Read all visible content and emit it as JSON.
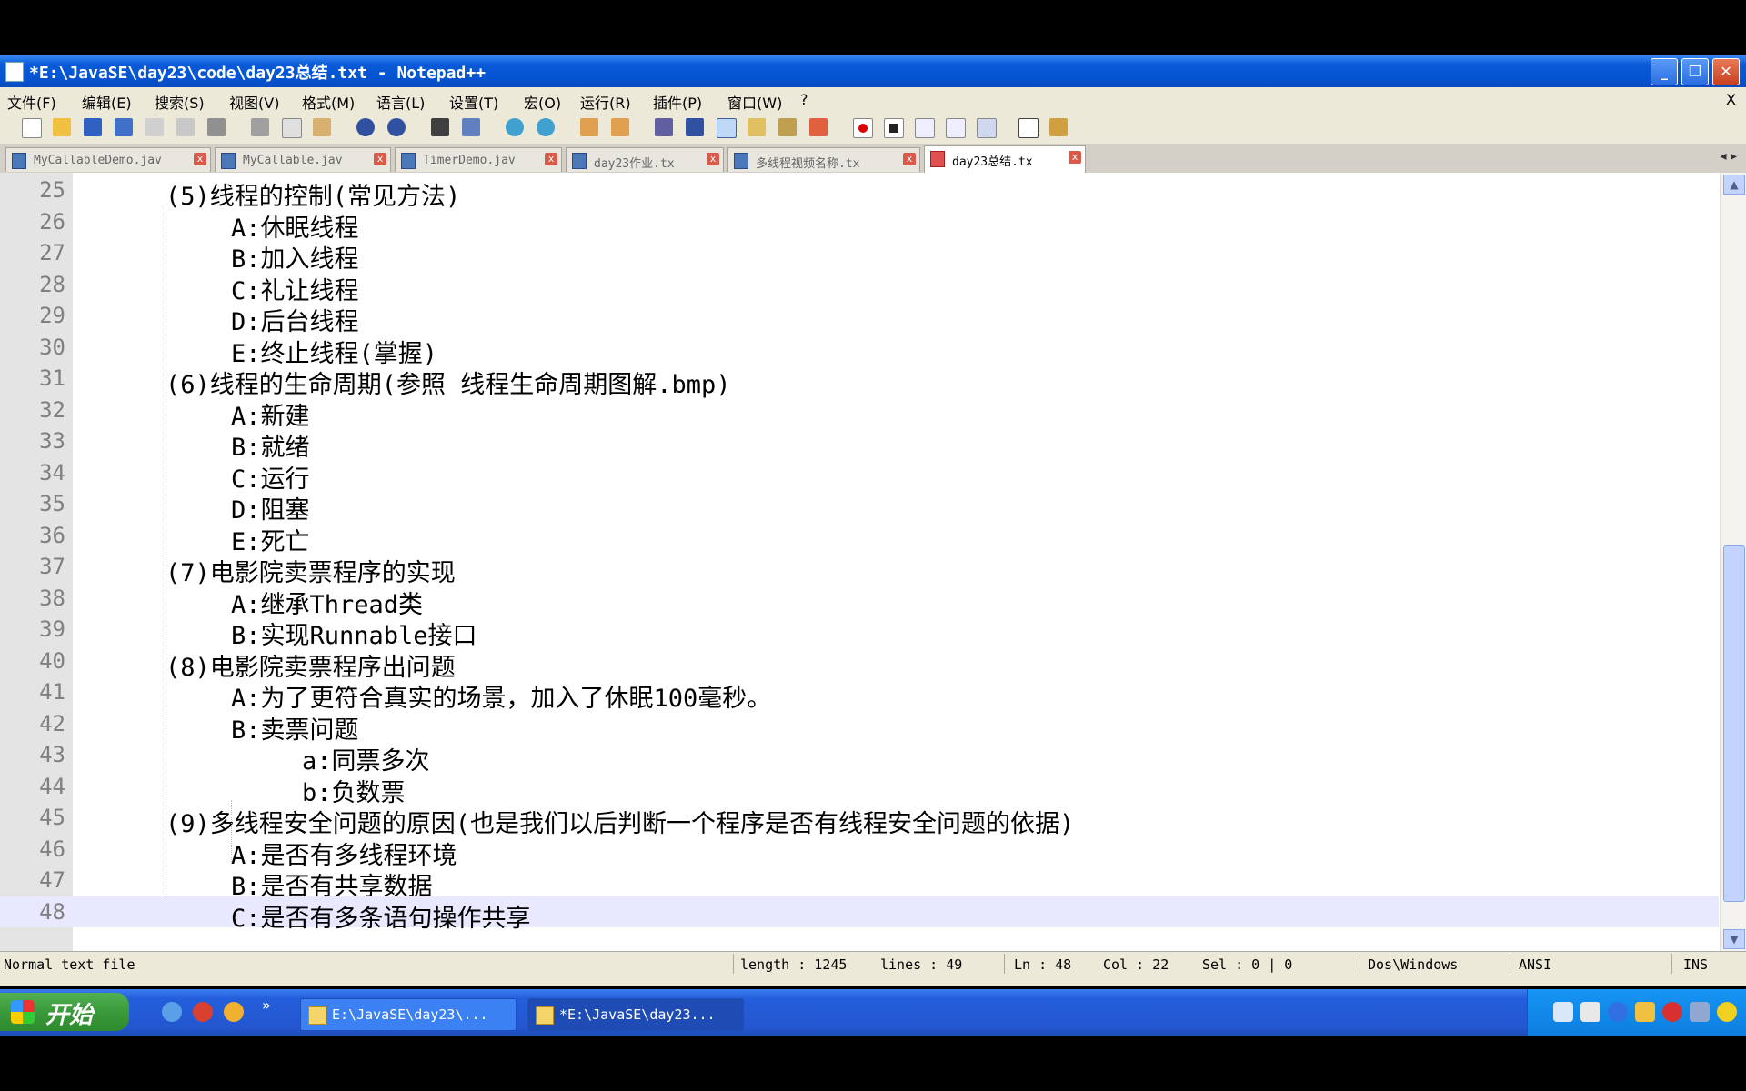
{
  "window": {
    "title": "*E:\\JavaSE\\day23\\code\\day23总结.txt - Notepad++",
    "min": "_",
    "max": "❐",
    "close": "✕"
  },
  "menu": [
    "文件(F)",
    "编辑(E)",
    "搜索(S)",
    "视图(V)",
    "格式(M)",
    "语言(L)",
    "设置(T)",
    "宏(O)",
    "运行(R)",
    "插件(P)",
    "窗口(W)",
    "?"
  ],
  "menu_close": "X",
  "tabs": [
    {
      "label": "MyCallableDemo.jav",
      "active": false
    },
    {
      "label": "MyCallable.jav",
      "active": false
    },
    {
      "label": "TimerDemo.jav",
      "active": false
    },
    {
      "label": "day23作业.tx",
      "active": false
    },
    {
      "label": "多线程视频名称.tx",
      "active": false
    },
    {
      "label": "day23总结.tx",
      "active": true
    }
  ],
  "tab_close": "x",
  "tab_arrows": "◂ ▸",
  "lines": [
    {
      "n": "25",
      "indent": 1,
      "text": "(5)线程的控制(常见方法)"
    },
    {
      "n": "26",
      "indent": 2,
      "text": "A:休眠线程"
    },
    {
      "n": "27",
      "indent": 2,
      "text": "B:加入线程"
    },
    {
      "n": "28",
      "indent": 2,
      "text": "C:礼让线程"
    },
    {
      "n": "29",
      "indent": 2,
      "text": "D:后台线程"
    },
    {
      "n": "30",
      "indent": 2,
      "text": "E:终止线程(掌握)"
    },
    {
      "n": "31",
      "indent": 1,
      "text": "(6)线程的生命周期(参照  线程生命周期图解.bmp)"
    },
    {
      "n": "32",
      "indent": 2,
      "text": "A:新建"
    },
    {
      "n": "33",
      "indent": 2,
      "text": "B:就绪"
    },
    {
      "n": "34",
      "indent": 2,
      "text": "C:运行"
    },
    {
      "n": "35",
      "indent": 2,
      "text": "D:阻塞"
    },
    {
      "n": "36",
      "indent": 2,
      "text": "E:死亡"
    },
    {
      "n": "37",
      "indent": 1,
      "text": "(7)电影院卖票程序的实现"
    },
    {
      "n": "38",
      "indent": 2,
      "text": "A:继承Thread类"
    },
    {
      "n": "39",
      "indent": 2,
      "text": "B:实现Runnable接口"
    },
    {
      "n": "40",
      "indent": 1,
      "text": "(8)电影院卖票程序出问题"
    },
    {
      "n": "41",
      "indent": 2,
      "text": "A:为了更符合真实的场景，加入了休眠100毫秒。"
    },
    {
      "n": "42",
      "indent": 2,
      "text": "B:卖票问题"
    },
    {
      "n": "43",
      "indent": 3,
      "text": "a:同票多次"
    },
    {
      "n": "44",
      "indent": 3,
      "text": "b:负数票"
    },
    {
      "n": "45",
      "indent": 1,
      "text": "(9)多线程安全问题的原因(也是我们以后判断一个程序是否有线程安全问题的依据)"
    },
    {
      "n": "46",
      "indent": 2,
      "text": "A:是否有多线程环境"
    },
    {
      "n": "47",
      "indent": 2,
      "text": "B:是否有共享数据"
    },
    {
      "n": "48",
      "indent": 2,
      "text": "C:是否有多条语句操作共享"
    }
  ],
  "current_line": "48",
  "status": {
    "type": "Normal text file",
    "length": "length : 1245",
    "lines": "lines : 49",
    "ln": "Ln : 48",
    "col": "Col : 22",
    "sel": "Sel : 0 | 0",
    "eol": "Dos\\Windows",
    "encoding": "ANSI",
    "mode": "INS"
  },
  "taskbar": {
    "start": "开始",
    "tasks": [
      {
        "label": "E:\\JavaSE\\day23\\...",
        "active": false
      },
      {
        "label": "*E:\\JavaSE\\day23...",
        "active": true
      }
    ],
    "quicklaunch_more": "»"
  },
  "colors": {
    "accent": "#0554d2",
    "current_line": "#e8e8ff",
    "start_green": "#3a9a3a"
  }
}
